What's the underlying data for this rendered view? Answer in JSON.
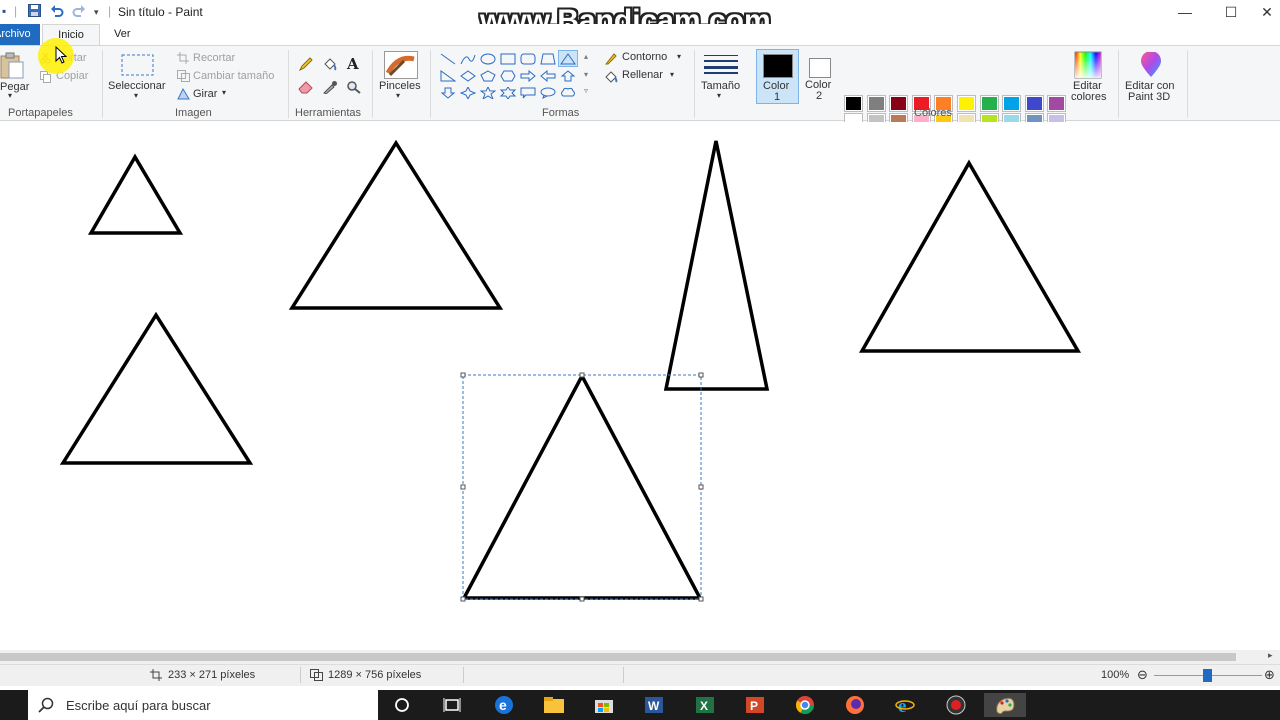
{
  "titlebar": {
    "title": "Sin título - Paint",
    "watermark": "www.Bandicam.com"
  },
  "tabs": {
    "archivo": "Archivo",
    "inicio": "Inicio",
    "ver": "Ver"
  },
  "ribbon": {
    "portapapeles": {
      "label": "Portapapeles",
      "pegar": "Pegar",
      "cortar": "Cortar",
      "copiar": "Copiar"
    },
    "imagen": {
      "label": "Imagen",
      "seleccionar": "Seleccionar",
      "recortar": "Recortar",
      "cambiar_tamano": "Cambiar tamaño",
      "girar": "Girar"
    },
    "herramientas": {
      "label": "Herramientas"
    },
    "pinceles": {
      "label": "Pinceles"
    },
    "formas": {
      "label": "Formas",
      "contorno": "Contorno",
      "rellenar": "Rellenar"
    },
    "tamano": "Tamaño",
    "color1": {
      "line1": "Color",
      "line2": "1",
      "value": "#000000"
    },
    "color2": {
      "line1": "Color",
      "line2": "2",
      "value": "#ffffff"
    },
    "colores": {
      "label": "Colores",
      "palette_row1": [
        "#000000",
        "#7f7f7f",
        "#880015",
        "#ed1c24",
        "#ff7f27",
        "#fff200",
        "#22b14c",
        "#00a2e8",
        "#3f48cc",
        "#a349a4"
      ],
      "palette_row2": [
        "#ffffff",
        "#c3c3c3",
        "#b97a57",
        "#ffaec9",
        "#ffc90e",
        "#efe4b0",
        "#b5e61d",
        "#99d9ea",
        "#7092be",
        "#c8bfe7"
      ]
    },
    "editar_colores": {
      "line1": "Editar",
      "line2": "colores"
    },
    "editar_paint3d": {
      "line1": "Editar con",
      "line2": "Paint 3D"
    }
  },
  "status": {
    "selection_size": "233 × 271 píxeles",
    "canvas_size": "1289 × 756 píxeles",
    "zoom": "100%"
  },
  "taskbar": {
    "search_placeholder": "Escribe aquí para buscar"
  }
}
